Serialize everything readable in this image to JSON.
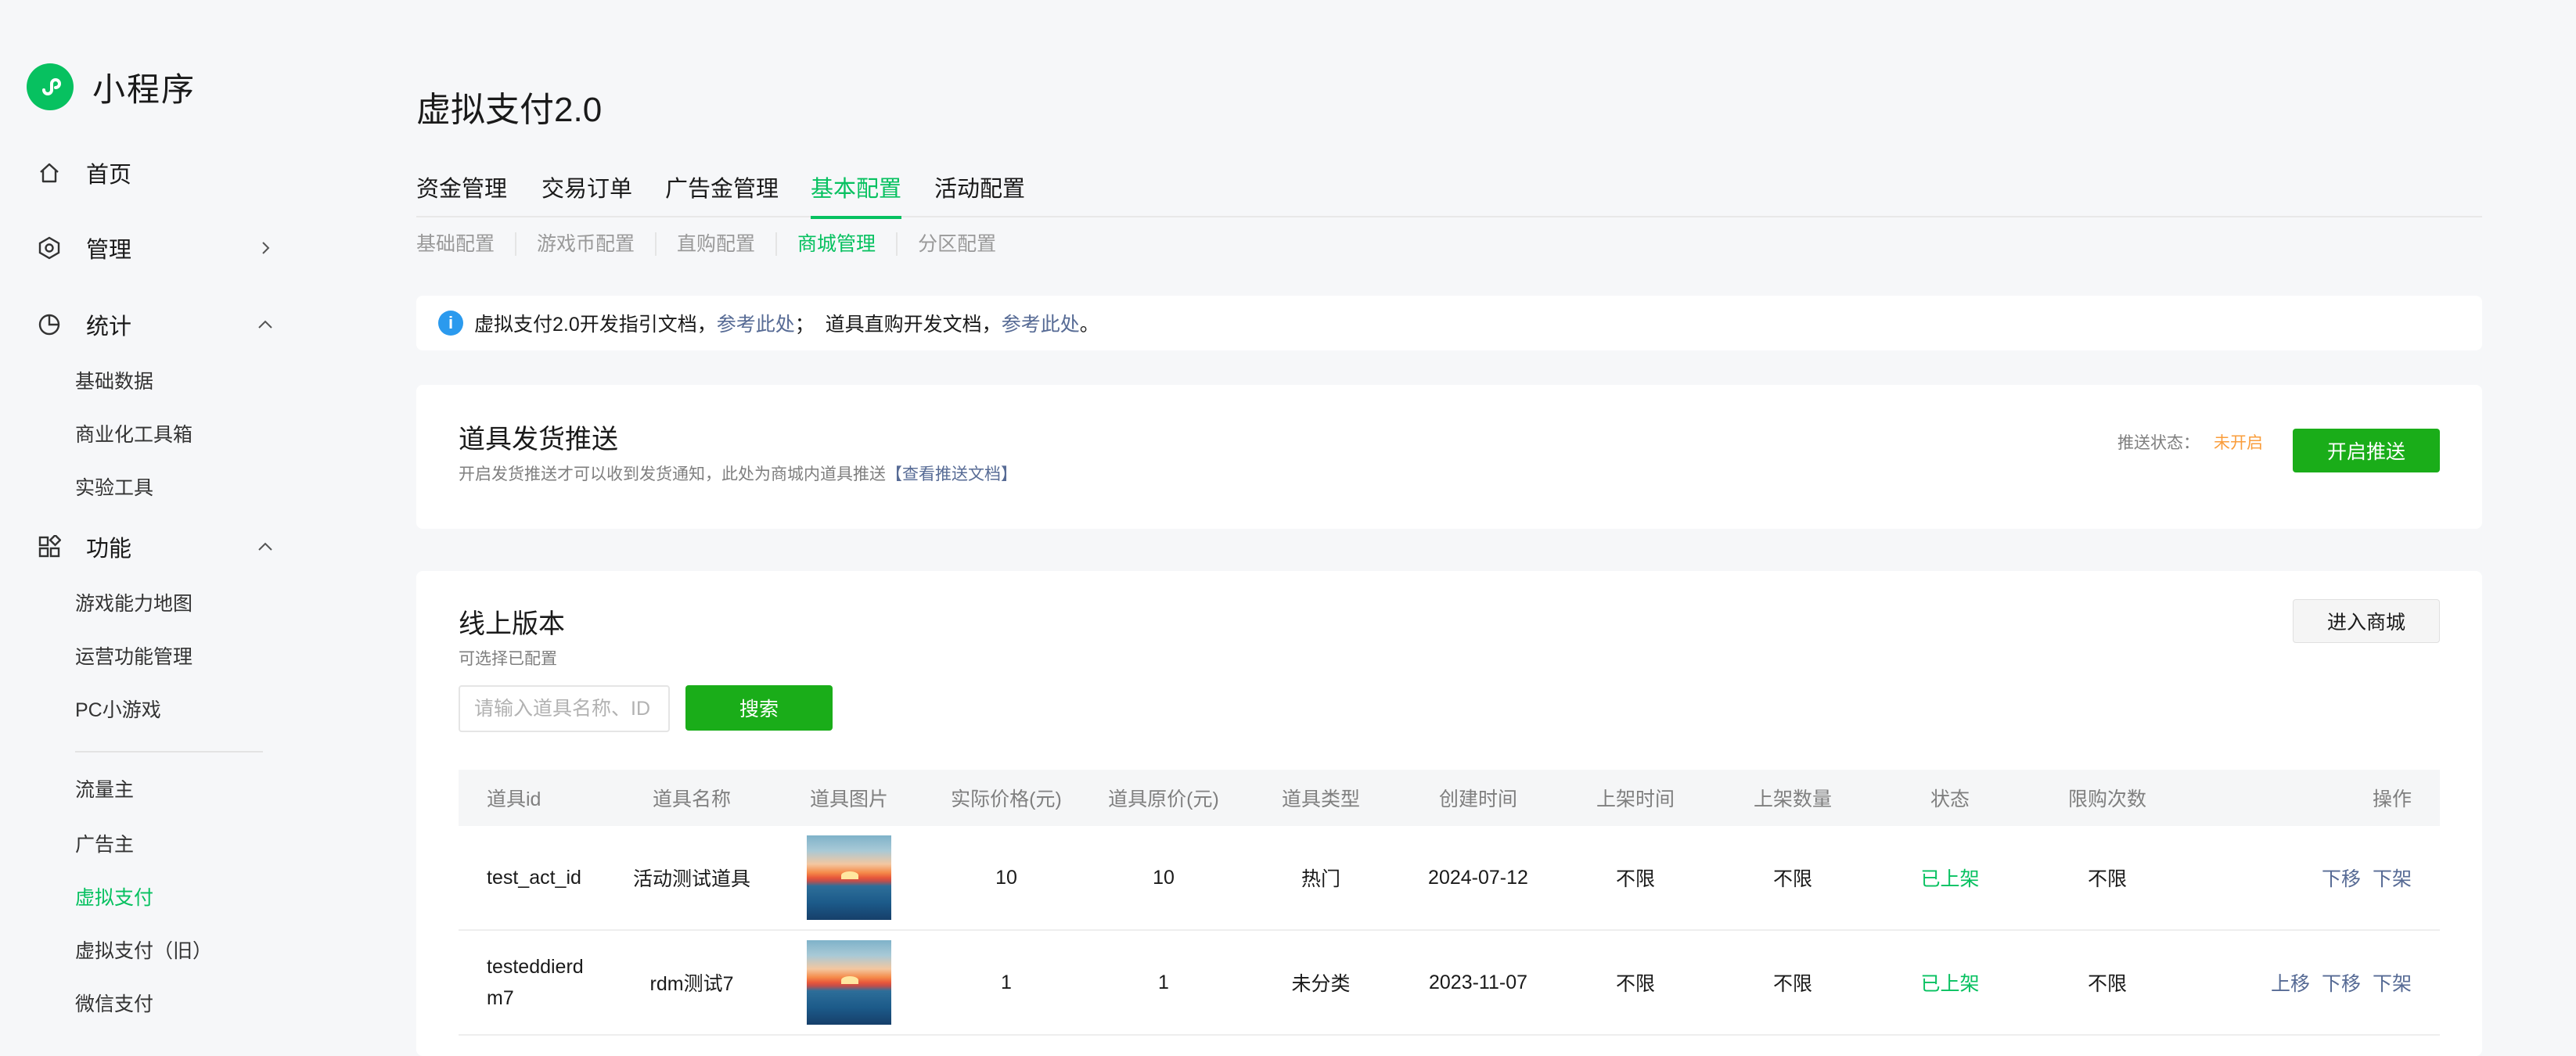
{
  "brand": {
    "name": "小程序"
  },
  "sidebar": {
    "home": "首页",
    "manage": "管理",
    "stats": {
      "label": "统计",
      "items": [
        "基础数据",
        "商业化工具箱",
        "实验工具"
      ]
    },
    "features": {
      "label": "功能",
      "items": [
        "游戏能力地图",
        "运营功能管理",
        "PC小游戏"
      ]
    },
    "money": {
      "items": [
        "流量主",
        "广告主",
        "虚拟支付",
        "虚拟支付（旧）",
        "微信支付"
      ]
    }
  },
  "page": {
    "title": "虚拟支付2.0"
  },
  "tabs": [
    "资金管理",
    "交易订单",
    "广告金管理",
    "基本配置",
    "活动配置"
  ],
  "subtabs": [
    "基础配置",
    "游戏币配置",
    "直购配置",
    "商城管理",
    "分区配置"
  ],
  "notice": {
    "text1": "虚拟支付2.0开发指引文档，",
    "link1": "参考此处",
    "text2": "；  道具直购开发文档，",
    "link2": "参考此处",
    "text3": "。"
  },
  "push": {
    "title": "道具发货推送",
    "desc": "开启发货推送才可以收到发货通知，此处为商城内道具推送",
    "doc_link": "【查看推送文档】",
    "status_label": "推送状态：",
    "status_value": "未开启",
    "button": "开启推送"
  },
  "online": {
    "title": "线上版本",
    "desc": "可选择已配置",
    "enter_button": "进入商城",
    "search_placeholder": "请输入道具名称、ID",
    "search_button": "搜索"
  },
  "table": {
    "headers": [
      "道具id",
      "道具名称",
      "道具图片",
      "实际价格(元)",
      "道具原价(元)",
      "道具类型",
      "创建时间",
      "上架时间",
      "上架数量",
      "状态",
      "限购次数",
      "操作"
    ],
    "rows": [
      {
        "id": "test_act_id",
        "name": "活动测试道具",
        "price": "10",
        "original": "10",
        "type": "热门",
        "created": "2024-07-12",
        "on_time": "不限",
        "qty": "不限",
        "status": "已上架",
        "limit": "不限",
        "ops": [
          "下移",
          "下架"
        ]
      },
      {
        "id": "testeddierdm7",
        "name": "rdm测试7",
        "price": "1",
        "original": "1",
        "type": "未分类",
        "created": "2023-11-07",
        "on_time": "不限",
        "qty": "不限",
        "status": "已上架",
        "limit": "不限",
        "ops": [
          "上移",
          "下移",
          "下架"
        ]
      }
    ]
  },
  "colors": {
    "accent": "#07c160",
    "primary_button": "#1aad19",
    "link": "#576b95",
    "warning": "#fa9d3b",
    "info": "#2b9aee"
  }
}
